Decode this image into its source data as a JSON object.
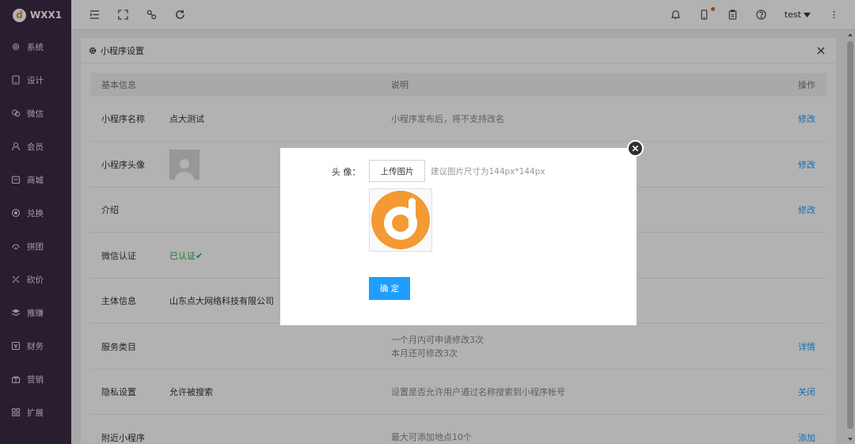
{
  "brand": {
    "name": "WXX1",
    "logo_letter": "d"
  },
  "sidebar": {
    "items": [
      {
        "label": "系统",
        "icon": "gear-icon"
      },
      {
        "label": "设计",
        "icon": "tablet-icon"
      },
      {
        "label": "微信",
        "icon": "wechat-icon"
      },
      {
        "label": "会员",
        "icon": "user-icon"
      },
      {
        "label": "商城",
        "icon": "shop-icon"
      },
      {
        "label": "兑换",
        "icon": "exchange-icon"
      },
      {
        "label": "拼团",
        "icon": "group-icon"
      },
      {
        "label": "砍价",
        "icon": "cut-icon"
      },
      {
        "label": "推赚",
        "icon": "layers-icon"
      },
      {
        "label": "财务",
        "icon": "finance-icon"
      },
      {
        "label": "营销",
        "icon": "gift-icon"
      },
      {
        "label": "扩展",
        "icon": "grid-icon"
      }
    ]
  },
  "header": {
    "user": "test"
  },
  "panel": {
    "title": "小程序设置",
    "columns": [
      "基本信息",
      "说明",
      "操作"
    ],
    "rows": [
      {
        "name": "小程序名称",
        "value": "点大测试",
        "desc": [
          "小程序发布后，将不支持改名"
        ],
        "action": "修改"
      },
      {
        "name": "小程序头像",
        "value": "",
        "desc": [],
        "action": "修改"
      },
      {
        "name": "介绍",
        "value": "",
        "desc": [],
        "action": "修改"
      },
      {
        "name": "微信认证",
        "value": "已认证✔",
        "desc": [],
        "action": ""
      },
      {
        "name": "主体信息",
        "value": "山东点大网络科技有限公司",
        "desc": [],
        "action": ""
      },
      {
        "name": "服务类目",
        "value": "",
        "desc": [
          "一个月内可申请修改3次",
          "本月还可修改3次"
        ],
        "action": "详情"
      },
      {
        "name": "隐私设置",
        "value": "允许被搜索",
        "desc": [
          "设置是否允许用户通过名称搜索到小程序帐号"
        ],
        "action": "关闭"
      },
      {
        "name": "附近小程序",
        "value": "",
        "desc": [
          "最大可添加地点10个"
        ],
        "action": "添加"
      }
    ]
  },
  "modal": {
    "label": "头 像：",
    "upload_label": "上传图片",
    "hint": "建议图片尺寸为144px*144px",
    "confirm_label": "确 定"
  },
  "colors": {
    "sidebar": "#3b2a45",
    "accent": "#1e9fff",
    "brand_orange": "#f08a24",
    "success": "#2eaa4a"
  }
}
